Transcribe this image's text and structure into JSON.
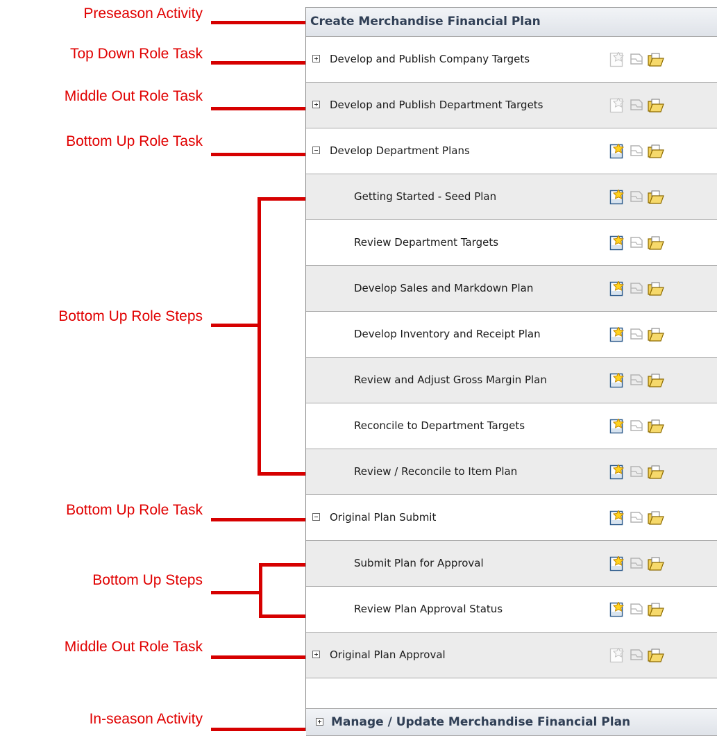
{
  "annotations": [
    {
      "id": "preseason-activity",
      "label": "Preseason Activity"
    },
    {
      "id": "top-down-role-task",
      "label": "Top Down Role Task"
    },
    {
      "id": "middle-out-role-task-1",
      "label": "Middle Out Role Task"
    },
    {
      "id": "bottom-up-role-task-1",
      "label": "Bottom Up Role Task"
    },
    {
      "id": "bottom-up-role-steps",
      "label": "Bottom Up Role Steps"
    },
    {
      "id": "bottom-up-role-task-2",
      "label": "Bottom Up Role Task"
    },
    {
      "id": "bottom-up-steps",
      "label": "Bottom Up Steps"
    },
    {
      "id": "middle-out-role-task-2",
      "label": "Middle Out Role Task"
    },
    {
      "id": "in-season-activity",
      "label": "In-season Activity"
    }
  ],
  "panel": {
    "header_title": "Create Merchandise Financial Plan",
    "footer_title": "Manage / Update Merchandise Financial Plan",
    "rows": [
      {
        "label": "Develop and Publish Company Targets",
        "kind": "task",
        "expander": "plus",
        "new_enabled": false
      },
      {
        "label": "Develop and Publish Department Targets",
        "kind": "task",
        "expander": "plus",
        "new_enabled": false
      },
      {
        "label": "Develop Department Plans",
        "kind": "task",
        "expander": "minus",
        "new_enabled": true
      },
      {
        "label": "Getting Started - Seed Plan",
        "kind": "step",
        "new_enabled": true
      },
      {
        "label": "Review Department Targets",
        "kind": "step",
        "new_enabled": true
      },
      {
        "label": "Develop Sales and Markdown Plan",
        "kind": "step",
        "new_enabled": true
      },
      {
        "label": "Develop Inventory and Receipt Plan",
        "kind": "step",
        "new_enabled": true
      },
      {
        "label": "Review and Adjust Gross Margin Plan",
        "kind": "step",
        "new_enabled": true
      },
      {
        "label": "Reconcile to Department Targets",
        "kind": "step",
        "new_enabled": true
      },
      {
        "label": "Review / Reconcile to Item Plan",
        "kind": "step",
        "new_enabled": true
      },
      {
        "label": "Original Plan Submit",
        "kind": "task",
        "expander": "minus",
        "new_enabled": true
      },
      {
        "label": "Submit Plan for Approval",
        "kind": "step",
        "new_enabled": true
      },
      {
        "label": "Review Plan Approval Status",
        "kind": "step",
        "new_enabled": true
      },
      {
        "label": "Original Plan Approval",
        "kind": "task",
        "expander": "plus",
        "new_enabled": false
      }
    ],
    "row_icons": [
      "new-workbook-icon",
      "document-icon",
      "open-folder-icon"
    ]
  },
  "colors": {
    "annotation": "#e00000",
    "header_text": "#303f55",
    "row_alt_bg": "#ececec",
    "row_border": "#a9a9a9"
  }
}
